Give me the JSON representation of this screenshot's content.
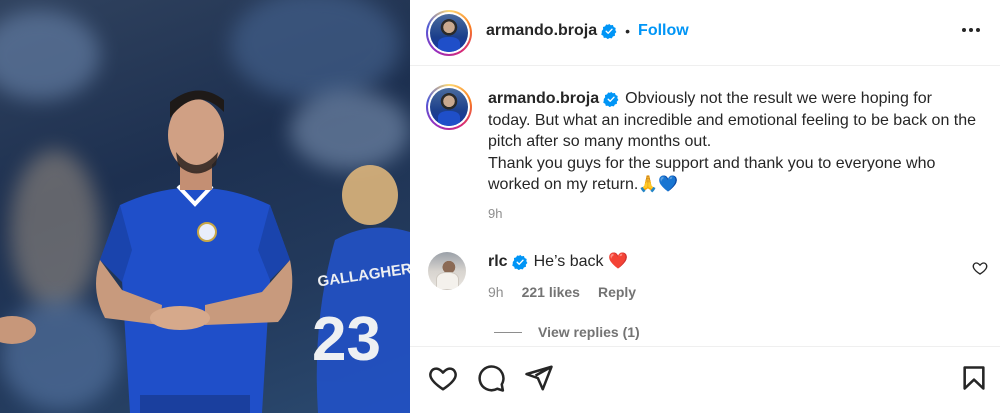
{
  "post": {
    "username": "armando.broja",
    "follow_label": "Follow",
    "separator": "•"
  },
  "caption": {
    "username": "armando.broja",
    "text": "Obviously not the result we were hoping for today. But what an incredible and emotional feeling to be back on the pitch after so many months out.",
    "text2": "Thank you guys for the support and thank you to everyone who worked on my return.",
    "emoji": "🙏💙",
    "time": "9h"
  },
  "comment": {
    "username": "rlc",
    "text": "He’s back",
    "emoji": "❤️",
    "time": "9h",
    "likes": "221 likes",
    "reply_label": "Reply",
    "view_replies": "View replies (1)"
  },
  "photo": {
    "shirt_number": "23",
    "shirt_name": "GALLAGHER"
  },
  "colors": {
    "accent": "#0095f6",
    "verified": "#0095f6",
    "heart": "#ed4956",
    "chelsea_blue": "#1f4fc9"
  },
  "icons": [
    "verified-badge-icon",
    "more-options-icon",
    "heart-icon",
    "comment-icon",
    "share-icon",
    "bookmark-icon"
  ]
}
